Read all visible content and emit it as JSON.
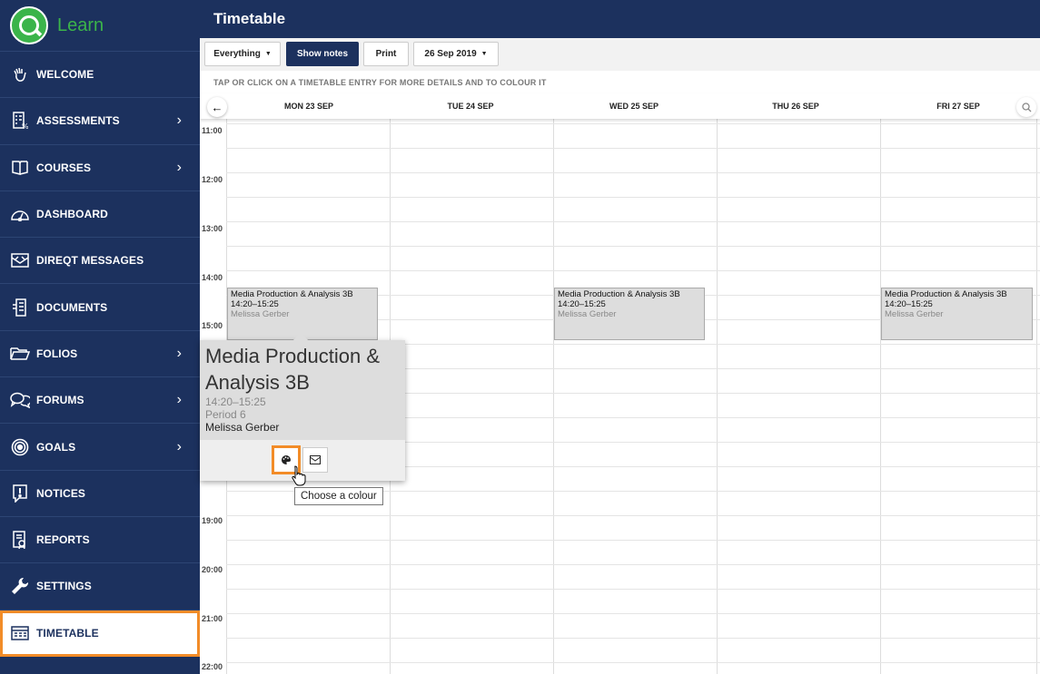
{
  "app": {
    "logo_text": "Learn"
  },
  "sidebar": {
    "items": [
      {
        "label": "WELCOME",
        "icon": "hand-wave-icon",
        "chevron": false
      },
      {
        "label": "ASSESSMENTS",
        "icon": "assessment-icon",
        "chevron": true
      },
      {
        "label": "COURSES",
        "icon": "book-icon",
        "chevron": true
      },
      {
        "label": "DASHBOARD",
        "icon": "speedometer-icon",
        "chevron": false
      },
      {
        "label": "DIREQT MESSAGES",
        "icon": "mail-icon",
        "chevron": false
      },
      {
        "label": "DOCUMENTS",
        "icon": "document-icon",
        "chevron": false
      },
      {
        "label": "FOLIOS",
        "icon": "folder-icon",
        "chevron": true
      },
      {
        "label": "FORUMS",
        "icon": "chat-icon",
        "chevron": true
      },
      {
        "label": "GOALS",
        "icon": "target-icon",
        "chevron": true
      },
      {
        "label": "NOTICES",
        "icon": "notice-icon",
        "chevron": false
      },
      {
        "label": "REPORTS",
        "icon": "report-icon",
        "chevron": false
      },
      {
        "label": "SETTINGS",
        "icon": "wrench-icon",
        "chevron": false
      },
      {
        "label": "TIMETABLE",
        "icon": "timetable-icon",
        "chevron": false,
        "active": true
      }
    ]
  },
  "header": {
    "title": "Timetable"
  },
  "toolbar": {
    "filter_label": "Everything",
    "show_notes_label": "Show notes",
    "print_label": "Print",
    "date_label": "26 Sep 2019"
  },
  "hint": "TAP OR CLICK ON A TIMETABLE ENTRY FOR MORE DETAILS AND TO COLOUR IT",
  "days": [
    "MON 23 SEP",
    "TUE 24 SEP",
    "WED 25 SEP",
    "THU 26 SEP",
    "FRI 27 SEP"
  ],
  "times": [
    "11:00",
    "12:00",
    "13:00",
    "14:00",
    "15:00",
    "19:00",
    "20:00",
    "21:00",
    "22:00"
  ],
  "events": [
    {
      "title": "Media Production & Analysis 3B",
      "time": "14:20–15:25",
      "teacher": "Melissa Gerber"
    },
    {
      "title": "Media Production & Analysis 3B",
      "time": "14:20–15:25",
      "teacher": "Melissa Gerber"
    },
    {
      "title": "Media Production & Analysis 3B",
      "time": "14:20–15:25",
      "teacher": "Melissa Gerber"
    }
  ],
  "popup": {
    "title": "Media Production & Analysis 3B",
    "time": "14:20–15:25",
    "period": "Period 6",
    "teacher": "Melissa Gerber"
  },
  "tooltip": "Choose a colour",
  "colors": {
    "brand_navy": "#1c315e",
    "brand_green": "#3bb44a",
    "highlight_orange": "#f28c28"
  }
}
